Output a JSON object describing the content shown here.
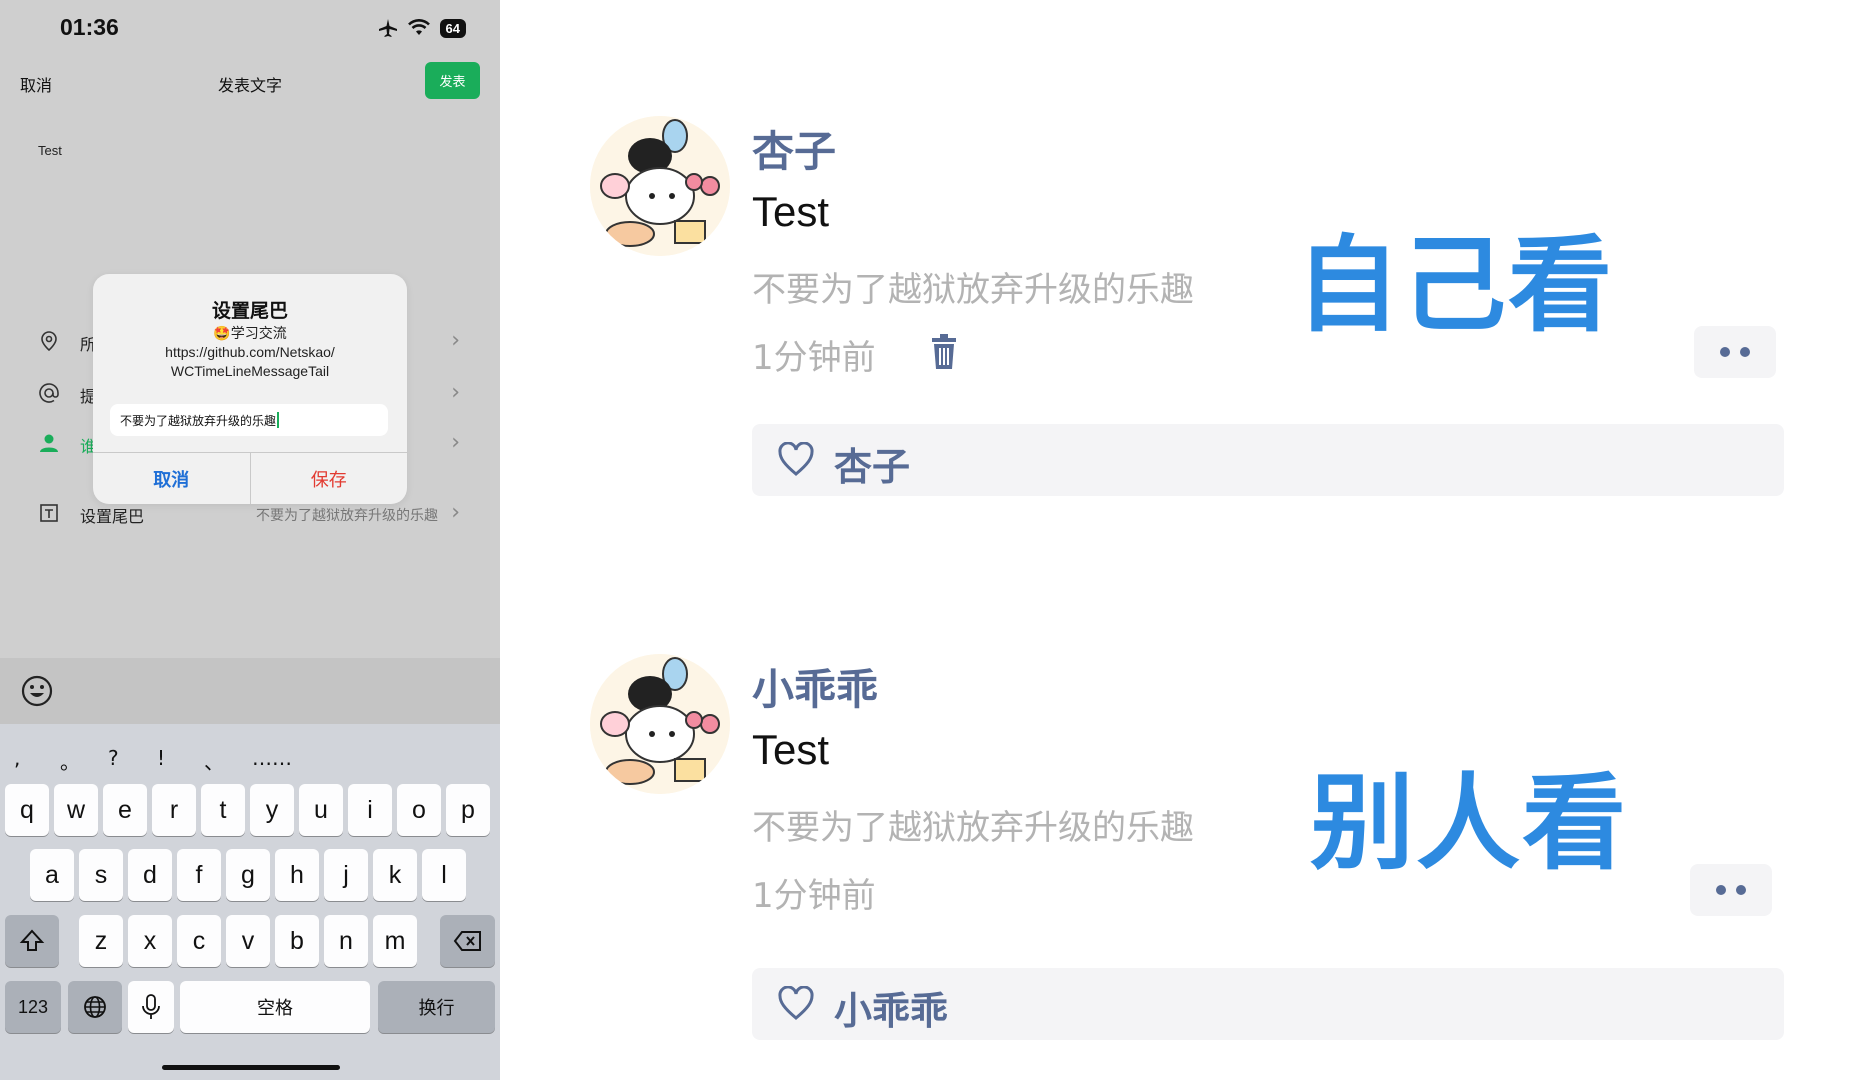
{
  "phone": {
    "status": {
      "time": "01:36",
      "battery": "64"
    },
    "nav": {
      "cancel": "取消",
      "title": "发表文字",
      "post": "发表"
    },
    "post_text": "Test",
    "rows": [
      {
        "label": "所",
        "value": ""
      },
      {
        "label": "提",
        "value": ""
      },
      {
        "label": "谁",
        "value": ""
      },
      {
        "label": "设置尾巴",
        "value": "不要为了越狱放弃升级的乐趣"
      }
    ],
    "dialog": {
      "title": "设置尾巴",
      "message": "🤩学习交流\nhttps://github.com/Netskao/\nWCTimeLineMessageTail",
      "input_value": "不要为了越狱放弃升级的乐趣",
      "cancel": "取消",
      "save": "保存"
    },
    "keyboard": {
      "punct": [
        ",",
        "。",
        "?",
        "!",
        "、",
        "……"
      ],
      "row1": [
        "q",
        "w",
        "e",
        "r",
        "t",
        "y",
        "u",
        "i",
        "o",
        "p"
      ],
      "row2": [
        "a",
        "s",
        "d",
        "f",
        "g",
        "h",
        "j",
        "k",
        "l"
      ],
      "row3": [
        "z",
        "x",
        "c",
        "v",
        "b",
        "n",
        "m"
      ],
      "num": "123",
      "space": "空格",
      "return": "换行"
    }
  },
  "moments": {
    "posts": [
      {
        "name": "杏子",
        "text": "Test",
        "tail": "不要为了越狱放弃升级的乐趣",
        "time": "1分钟前",
        "like": "杏子",
        "label": "自己看"
      },
      {
        "name": "小乖乖",
        "text": "Test",
        "tail": "不要为了越狱放弃升级的乐趣",
        "time": "1分钟前",
        "like": "小乖乖",
        "label": "别人看"
      }
    ]
  },
  "colors": {
    "wechat_green": "#1aad5a",
    "name_blue": "#576b95",
    "label_blue": "#2d8ae0",
    "save_red": "#e23b31"
  }
}
